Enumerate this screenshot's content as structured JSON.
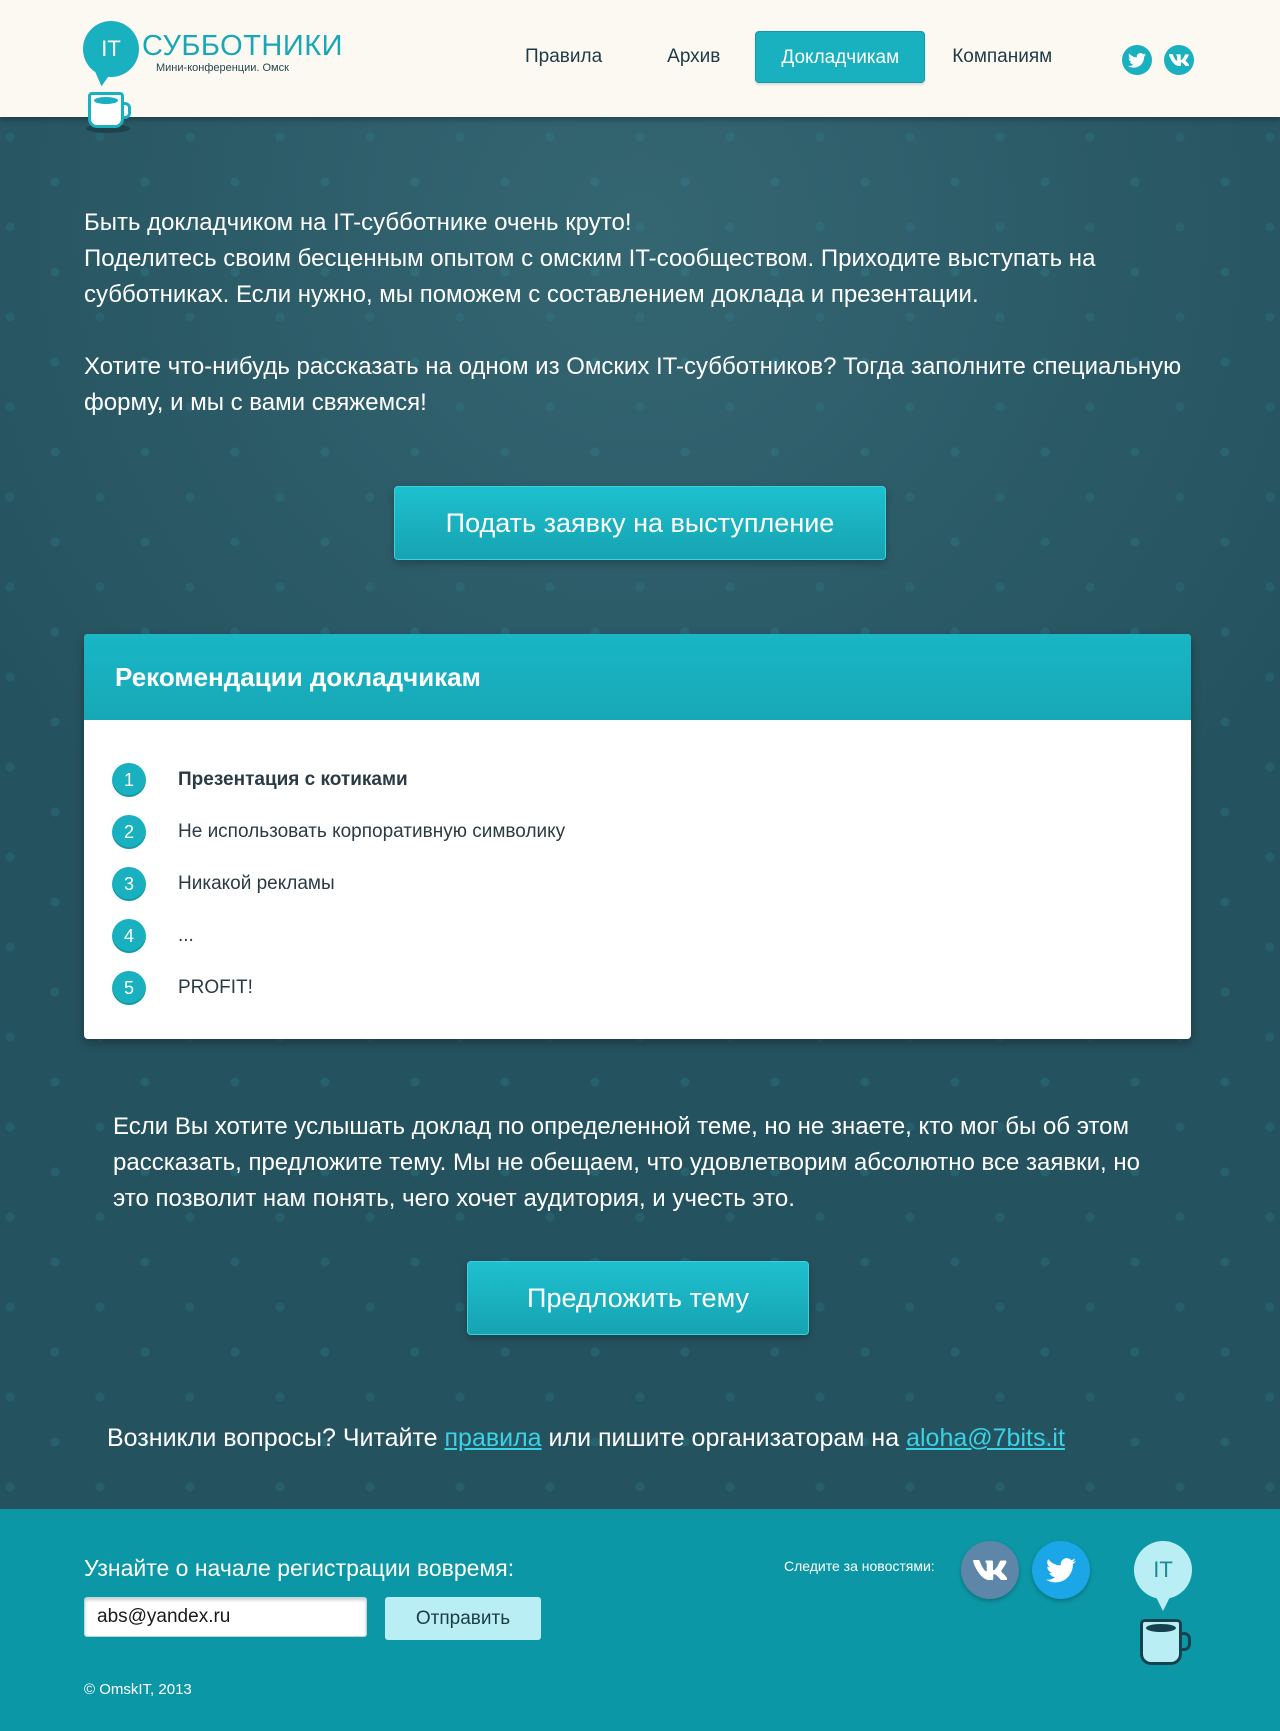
{
  "header": {
    "logo": {
      "bubble_text": "IT",
      "title": "СУББОТНИКИ",
      "subtitle": "Мини-конференции. Омск"
    },
    "nav": [
      {
        "label": "Правила",
        "active": false
      },
      {
        "label": "Архив",
        "active": false
      },
      {
        "label": "Докладчикам",
        "active": true
      },
      {
        "label": "Компаниям",
        "active": false
      }
    ],
    "social_icons": [
      "twitter-icon",
      "vk-icon"
    ]
  },
  "main": {
    "intro": [
      "Быть докладчиком на IT-субботнике очень круто!\nПоделитесь своим бесценным опытом с омским IT-сообществом. Приходите выступать на субботниках. Если нужно, мы поможем с составлением доклада и презентации.",
      "Хотите что-нибудь рассказать на одном из Омских IT-субботников? Тогда заполните специальную форму, и мы с вами свяжемся!"
    ],
    "apply_button": "Подать заявку на выступление",
    "recommendations": {
      "title": "Рекомендации докладчикам",
      "items": [
        {
          "num": "1",
          "text": "Презентация с котиками"
        },
        {
          "num": "2",
          "text": "Не использовать корпоративную символику"
        },
        {
          "num": "3",
          "text": "Никакой рекламы"
        },
        {
          "num": "4",
          "text": "..."
        },
        {
          "num": "5",
          "text": "PROFIT!"
        }
      ]
    },
    "topic_text": "Если Вы хотите услышать доклад по определенной теме, но не знаете, кто мог бы об этом рассказать, предложите тему.  Мы не обещаем, что удовлетворим абсолютно все заявки, но это позволит нам понять, чего хочет аудитория, и учесть это.",
    "topic_button": "Предложить тему",
    "questions": {
      "prefix": "Возникли вопросы? Читайте ",
      "rules_link": "правила",
      "middle": " или пишите организаторам на ",
      "email_link": "aloha@7bits.it"
    }
  },
  "footer": {
    "subscribe_label": "Узнайте о начале регистрации вовремя:",
    "email_value": "abs@yandex.ru",
    "send_button": "Отправить",
    "follow_label": "Следите за новостями:",
    "logo_text": "IT",
    "copyright": "©  OmskIT, 2013"
  },
  "colors": {
    "accent": "#19b0bf",
    "header_bg": "#fcf9f3",
    "main_bg": "#25525f",
    "footer_bg": "#0c97a6",
    "link": "#3cd2e6"
  }
}
